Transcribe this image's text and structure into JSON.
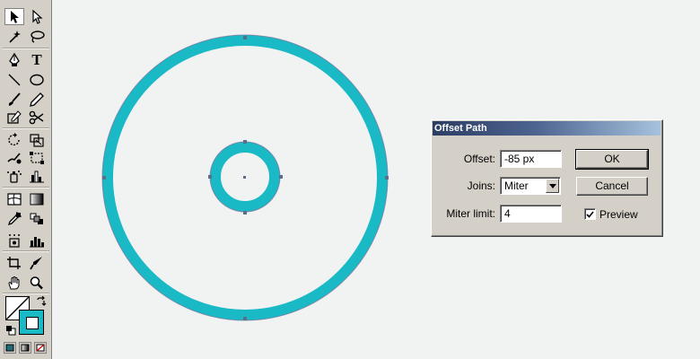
{
  "colors": {
    "path_stroke": "#1ab9c6",
    "anchor": "#5c6f8a",
    "canvas_bg": "#f1f2f2",
    "panel_bg": "#d4d0c8",
    "title_gradient_start": "#2c3d63",
    "title_gradient_end": "#a6c2dd"
  },
  "toolbox": {
    "type_tool_glyph": "T",
    "tools": [
      "selection-tool",
      "direct-selection-tool",
      "magic-wand-tool",
      "lasso-tool",
      "pen-tool",
      "type-tool",
      "line-tool",
      "ellipse-tool",
      "paintbrush-tool",
      "pencil-tool",
      "eraser-tool",
      "scissors-tool",
      "rotate-tool",
      "scale-tool",
      "warp-tool",
      "free-transform-tool",
      "symbol-sprayer-tool",
      "column-graph-tool",
      "mesh-tool",
      "gradient-tool",
      "eyedropper-tool",
      "blend-tool",
      "symbol-tool",
      "bar-graph-tool",
      "crop-tool",
      "slice-tool",
      "hand-tool",
      "zoom-tool"
    ],
    "active_tool": "selection-tool"
  },
  "dialog": {
    "title": "Offset Path",
    "offset_label": "Offset:",
    "offset_value": "-85 px",
    "joins_label": "Joins:",
    "joins_value": "Miter",
    "miter_label": "Miter limit:",
    "miter_value": "4",
    "ok_label": "OK",
    "cancel_label": "Cancel",
    "preview_label": "Preview",
    "preview_checked": true
  }
}
